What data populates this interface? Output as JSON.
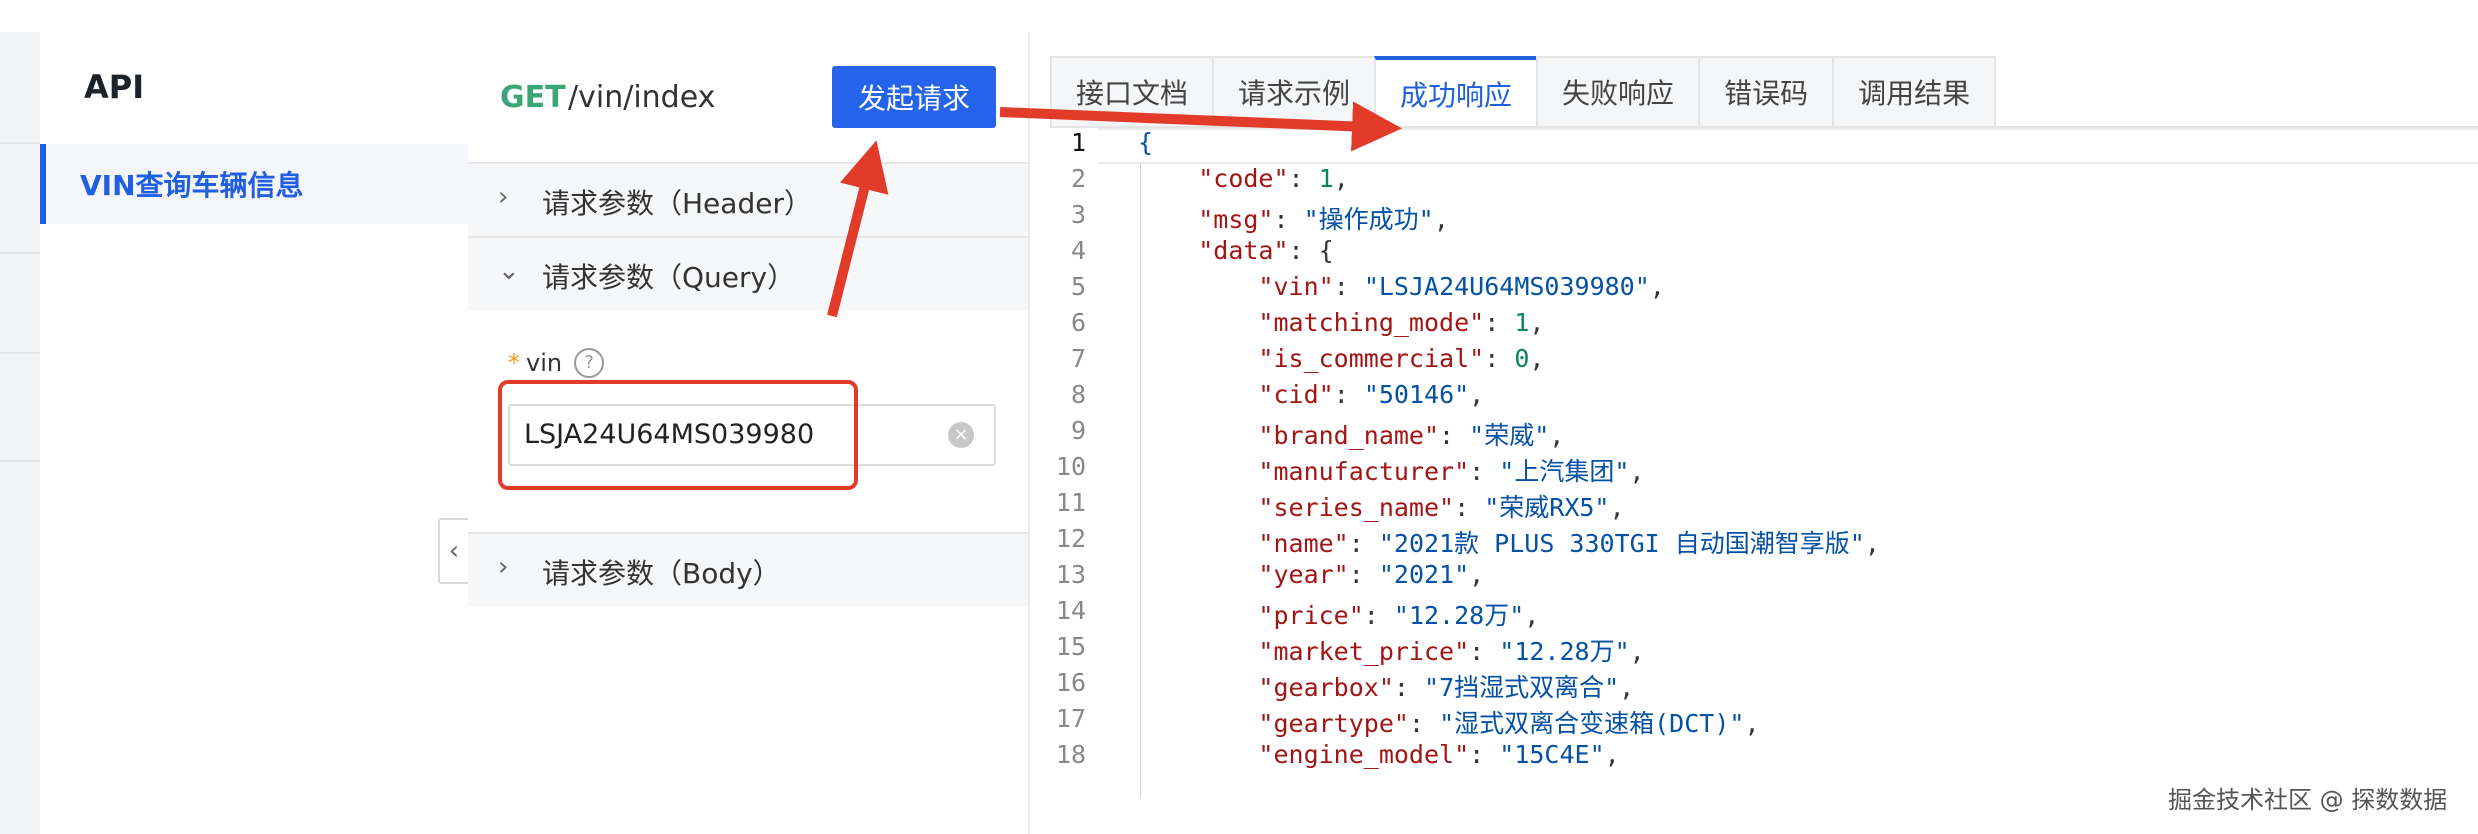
{
  "sidebar": {
    "title": "API",
    "items": [
      {
        "label": "VIN查询车辆信息"
      }
    ]
  },
  "request": {
    "method": "GET",
    "path": "/vin/index",
    "send_label": "发起请求",
    "sections": [
      {
        "label": "请求参数（Header）"
      },
      {
        "label": "请求参数（Query）"
      },
      {
        "label": "请求参数（Body）"
      }
    ],
    "param": {
      "required_mark": "*",
      "name": "vin",
      "help": "?",
      "value": "LSJA24U64MS039980"
    }
  },
  "tabs": [
    {
      "label": "接口文档"
    },
    {
      "label": "请求示例"
    },
    {
      "label": "成功响应"
    },
    {
      "label": "失败响应"
    },
    {
      "label": "错误码"
    },
    {
      "label": "调用结果"
    }
  ],
  "active_tab": "成功响应",
  "code_lines": [
    "{",
    "    \"code\": 1,",
    "    \"msg\": \"操作成功\",",
    "    \"data\": {",
    "        \"vin\": \"LSJA24U64MS039980\",",
    "        \"matching_mode\": 1,",
    "        \"is_commercial\": 0,",
    "        \"cid\": \"50146\",",
    "        \"brand_name\": \"荣威\",",
    "        \"manufacturer\": \"上汽集团\",",
    "        \"series_name\": \"荣威RX5\",",
    "        \"name\": \"2021款 PLUS 330TGI 自动国潮智享版\",",
    "        \"year\": \"2021\",",
    "        \"price\": \"12.28万\",",
    "        \"market_price\": \"12.28万\",",
    "        \"gearbox\": \"7挡湿式双离合\",",
    "        \"geartype\": \"湿式双离合变速箱(DCT)\",",
    "        \"engine_model\": \"15C4E\","
  ],
  "line_numbers": [
    "1",
    "2",
    "3",
    "4",
    "5",
    "6",
    "7",
    "8",
    "9",
    "10",
    "11",
    "12",
    "13",
    "14",
    "15",
    "16",
    "17",
    "18"
  ],
  "watermark": "掘金技术社区 @ 探数数据",
  "colors": {
    "accent": "#1f5fe0",
    "button": "#2563eb",
    "get": "#3aa676",
    "annotation": "#e23b2a"
  }
}
